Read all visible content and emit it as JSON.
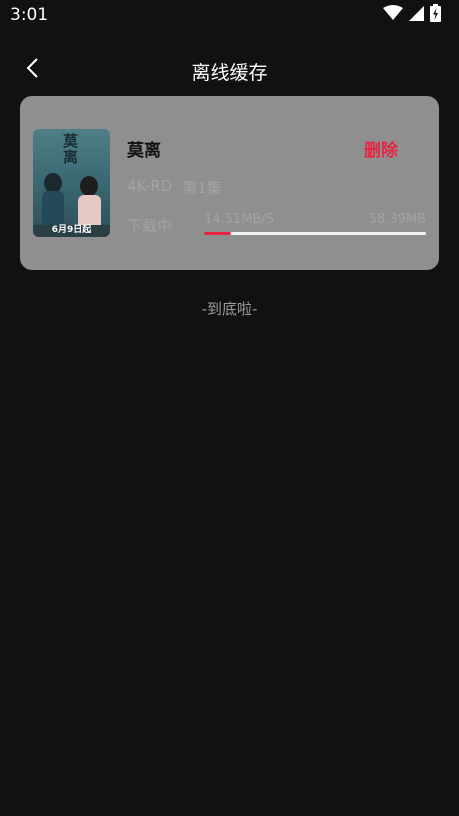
{
  "status_bar": {
    "time": "3:01",
    "icons": [
      "wifi-icon",
      "signal-icon",
      "battery-charging-icon"
    ]
  },
  "header": {
    "title": "离线缓存",
    "back_icon": "chevron-left-icon"
  },
  "downloads": [
    {
      "poster_title": "莫离",
      "poster_date": "6月9日起",
      "name": "莫离",
      "delete_label": "删除",
      "quality": "4K-RD",
      "episode": "第1集",
      "status": "下载中",
      "speed": "14.51MB/S",
      "size": "58.39MB",
      "progress": 0.12
    }
  ],
  "footer": {
    "end_text": "-到底啦-"
  },
  "colors": {
    "background": "#111111",
    "card": "#8f8f8f",
    "accent": "#e62642"
  }
}
